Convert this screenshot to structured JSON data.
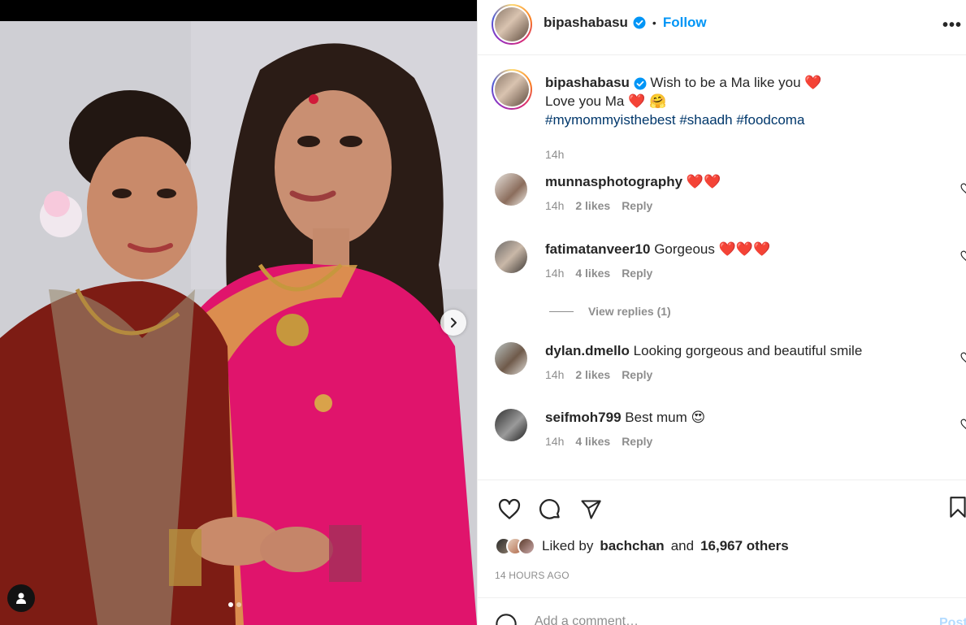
{
  "post": {
    "username": "bipashabasu",
    "follow_label": "Follow",
    "more_icon": "more-options-icon",
    "carousel": {
      "total_slides": 2,
      "active_slide": 1
    }
  },
  "caption": {
    "username": "bipashabasu",
    "line1": "Wish to be a Ma like you",
    "line2": "Love you Ma",
    "hashtags": [
      "#mymommyisthebest",
      "#shaadh",
      "#foodcoma"
    ],
    "time": "14h"
  },
  "comments": [
    {
      "username": "munnasphotography",
      "text": "",
      "time": "14h",
      "likes": "2 likes",
      "reply": "Reply",
      "hearts": 2
    },
    {
      "username": "fatimatanveer10",
      "text": "Gorgeous",
      "time": "14h",
      "likes": "4 likes",
      "reply": "Reply",
      "hearts": 3
    },
    {
      "username": "dylan.dmello",
      "text": "Looking gorgeous and beautiful smile",
      "time": "14h",
      "likes": "2 likes",
      "reply": "Reply",
      "hearts": 0
    },
    {
      "username": "seifmoh799",
      "text": "Best mum",
      "time": "14h",
      "likes": "4 likes",
      "reply": "Reply",
      "hearts": 0
    }
  ],
  "view_replies": "View replies (1)",
  "likes": {
    "prefix": "Liked by",
    "user": "bachchan",
    "joiner": "and",
    "others": "16,967 others"
  },
  "post_time": "14 HOURS AGO",
  "add_comment": {
    "placeholder": "Add a comment…",
    "post_label": "Post"
  },
  "colors": {
    "accent": "#0095f6",
    "hashtag": "#00376b",
    "heart": "#ed4956",
    "muted": "#8e8e8e"
  }
}
